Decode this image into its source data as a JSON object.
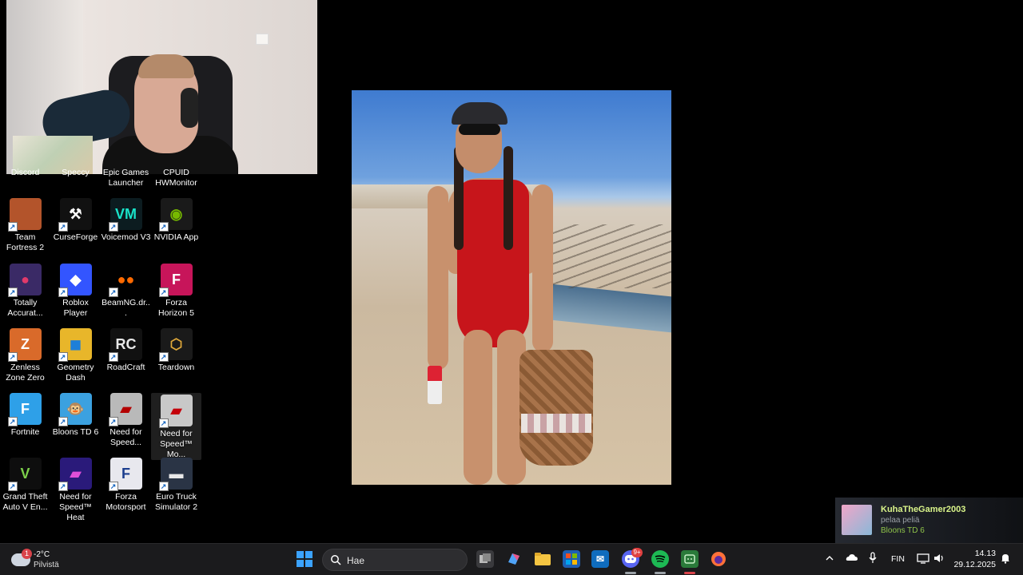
{
  "desktop": {
    "cut_labels": [
      "Discord",
      "Speccy",
      "Epic Games",
      "Launcher",
      "CPUID",
      "HWMonitor"
    ],
    "icons": [
      {
        "label": "Team Fortress 2",
        "glyph": "",
        "color": "#b3542b",
        "fg": "#fff"
      },
      {
        "label": "CurseForge",
        "glyph": "⚒",
        "color": "#111",
        "fg": "#fff"
      },
      {
        "label": "Voicemod V3",
        "glyph": "VM",
        "color": "#0c1c20",
        "fg": "#19e3c9"
      },
      {
        "label": "NVIDIA App",
        "glyph": "◉",
        "color": "#1a1a1a",
        "fg": "#76b900"
      },
      {
        "label": "Totally Accurat...",
        "glyph": "●",
        "color": "#3a2a66",
        "fg": "#e03a6a"
      },
      {
        "label": "Roblox Player",
        "glyph": "◆",
        "color": "#3355ff",
        "fg": "#fff"
      },
      {
        "label": "BeamNG.dr...",
        "glyph": "●●",
        "color": "#000",
        "fg": "#ff6a00"
      },
      {
        "label": "Forza Horizon 5",
        "glyph": "F",
        "color": "#c7155a",
        "fg": "#fff"
      },
      {
        "label": "Zenless Zone Zero",
        "glyph": "Z",
        "color": "#d96a2a",
        "fg": "#fff"
      },
      {
        "label": "Geometry Dash",
        "glyph": "◼",
        "color": "#e8b62a",
        "fg": "#1e7fd8"
      },
      {
        "label": "RoadCraft",
        "glyph": "RC",
        "color": "#111",
        "fg": "#e8e8e8"
      },
      {
        "label": "Teardown",
        "glyph": "⬡",
        "color": "#1a1a1a",
        "fg": "#e0a93a"
      },
      {
        "label": "Fortnite",
        "glyph": "F",
        "color": "#2ea0e8",
        "fg": "#fff"
      },
      {
        "label": "Bloons TD 6",
        "glyph": "🐵",
        "color": "#3ba1e0",
        "fg": "#fff"
      },
      {
        "label": "Need for Speed...",
        "glyph": "▰",
        "color": "#b9b9b9",
        "fg": "#b30000"
      },
      {
        "label": "Need for Speed™ Mo...",
        "glyph": "▰",
        "color": "#c8c8c8",
        "fg": "#c4000a"
      },
      {
        "label": "Grand Theft Auto V En...",
        "glyph": "V",
        "color": "#0e0e0e",
        "fg": "#7ccf4a"
      },
      {
        "label": "Need for Speed™ Heat",
        "glyph": "▰",
        "color": "#2a1a7a",
        "fg": "#e04fd8"
      },
      {
        "label": "Forza Motorsport",
        "glyph": "F",
        "color": "#e8e8ee",
        "fg": "#1c3e8e"
      },
      {
        "label": "Euro Truck Simulator 2",
        "glyph": "▬",
        "color": "#2a3445",
        "fg": "#e8e8e8"
      }
    ]
  },
  "notification": {
    "name": "KuhaTheGamer2003",
    "status": "pelaa peliä",
    "game": "Bloons TD 6"
  },
  "taskbar": {
    "weather": {
      "temp": "-2°C",
      "condition": "Pilvistä",
      "badge": "1"
    },
    "search_placeholder": "Hae",
    "discord_badge": "9+",
    "tray": {
      "language": "FIN"
    },
    "clock": {
      "time": "14.13",
      "date": "29.12.2025"
    }
  }
}
